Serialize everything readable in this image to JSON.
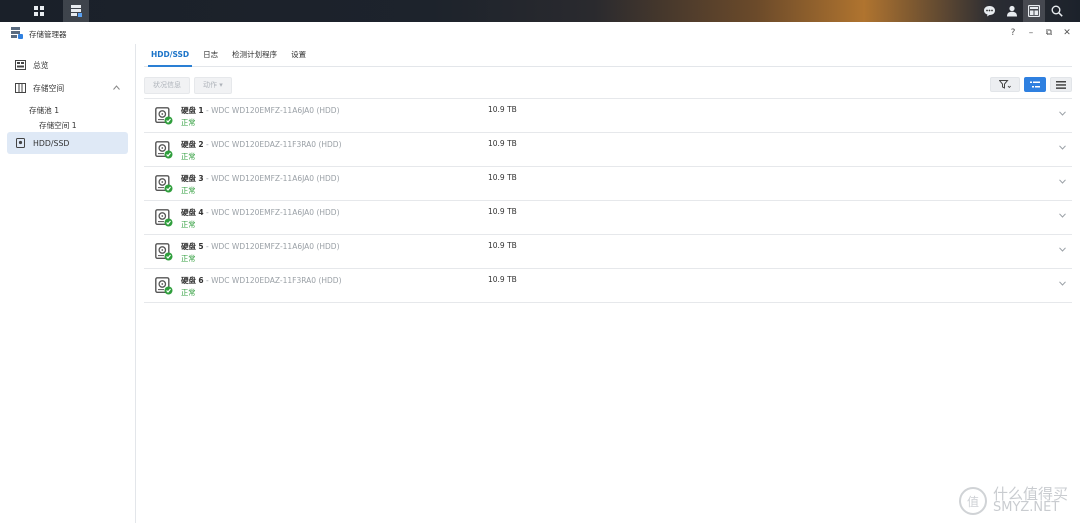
{
  "window": {
    "title": "存储管理器"
  },
  "window_controls": {
    "help": "?",
    "minimize": "–",
    "restore": "⧉",
    "close": "✕"
  },
  "sidebar": {
    "overview": "总览",
    "storage": "存储空间",
    "pool": "存储池 1",
    "volume": "存储空间 1",
    "hdd": "HDD/SSD"
  },
  "tabs": [
    "HDD/SSD",
    "日志",
    "检测计划程序",
    "设置"
  ],
  "toolbar": {
    "health_info": "状况信息",
    "action": "动作 ▾"
  },
  "disks": [
    {
      "label": "硬盘",
      "num": "1",
      "model": "WDC WD120EMFZ-11A6JA0 (HDD)",
      "status": "正常",
      "size": "10.9 TB"
    },
    {
      "label": "硬盘",
      "num": "2",
      "model": "WDC WD120EDAZ-11F3RA0 (HDD)",
      "status": "正常",
      "size": "10.9 TB"
    },
    {
      "label": "硬盘",
      "num": "3",
      "model": "WDC WD120EMFZ-11A6JA0 (HDD)",
      "status": "正常",
      "size": "10.9 TB"
    },
    {
      "label": "硬盘",
      "num": "4",
      "model": "WDC WD120EMFZ-11A6JA0 (HDD)",
      "status": "正常",
      "size": "10.9 TB"
    },
    {
      "label": "硬盘",
      "num": "5",
      "model": "WDC WD120EMFZ-11A6JA0 (HDD)",
      "status": "正常",
      "size": "10.9 TB"
    },
    {
      "label": "硬盘",
      "num": "6",
      "model": "WDC WD120EDAZ-11F3RA0 (HDD)",
      "status": "正常",
      "size": "10.9 TB"
    }
  ],
  "watermark": {
    "glyph": "值",
    "line1": "什么值得买",
    "line2": "SMYZ.NET"
  },
  "colors": {
    "accent": "#2f80e0",
    "status_ok": "#2f9e3c"
  }
}
